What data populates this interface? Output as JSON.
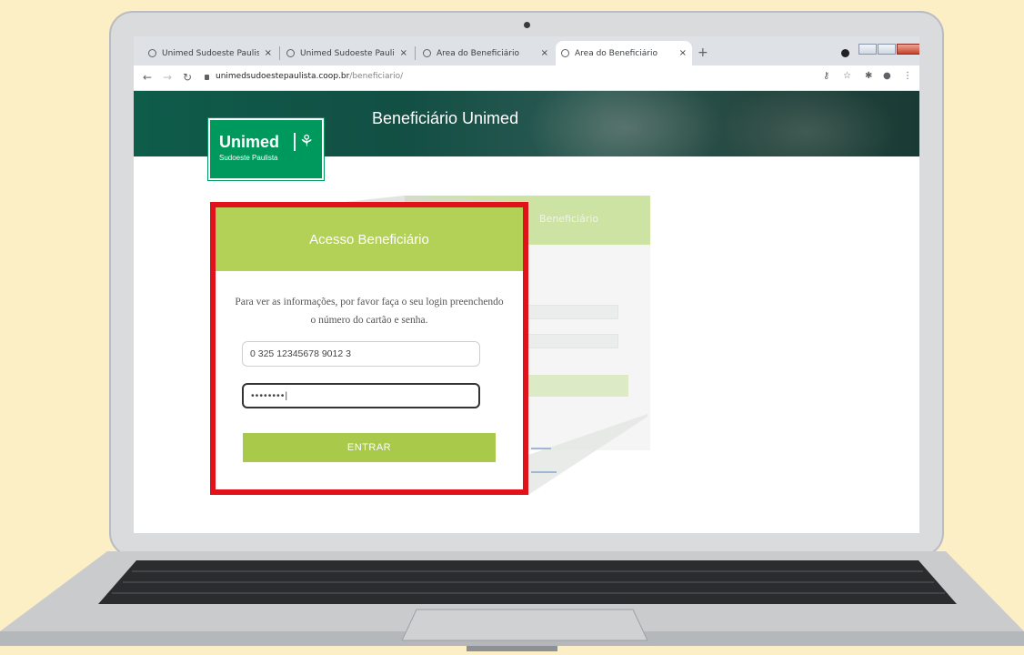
{
  "browser": {
    "tabs": [
      {
        "title": "Unimed Sudoeste Paulista - A m"
      },
      {
        "title": "Unimed Sudoeste Paulista - A m"
      },
      {
        "title": "Área do Beneficiário"
      },
      {
        "title": "Área do Beneficiário",
        "active": true
      }
    ],
    "tab_close": "×",
    "new_tab": "+",
    "url_host": "unimedsudoestepaulista.coop.br",
    "url_path": "/beneficiario/"
  },
  "page": {
    "hero_title": "Beneficiário Unimed",
    "logo_name": "Unimed",
    "logo_sub": "Sudoeste Paulista",
    "ghost_label": "Beneficiário"
  },
  "login": {
    "title": "Acesso Beneficiário",
    "instructions": "Para ver as informações, por favor faça o seu login preenchendo o número do cartão e senha.",
    "card_number": "0 325 12345678 9012 3",
    "password_masked": "••••••••|",
    "submit_label": "ENTRAR"
  },
  "colors": {
    "brand_green": "#00995d",
    "accent_green": "#b3d157",
    "highlight_red": "#e2121b",
    "background": "#fcefc6"
  }
}
